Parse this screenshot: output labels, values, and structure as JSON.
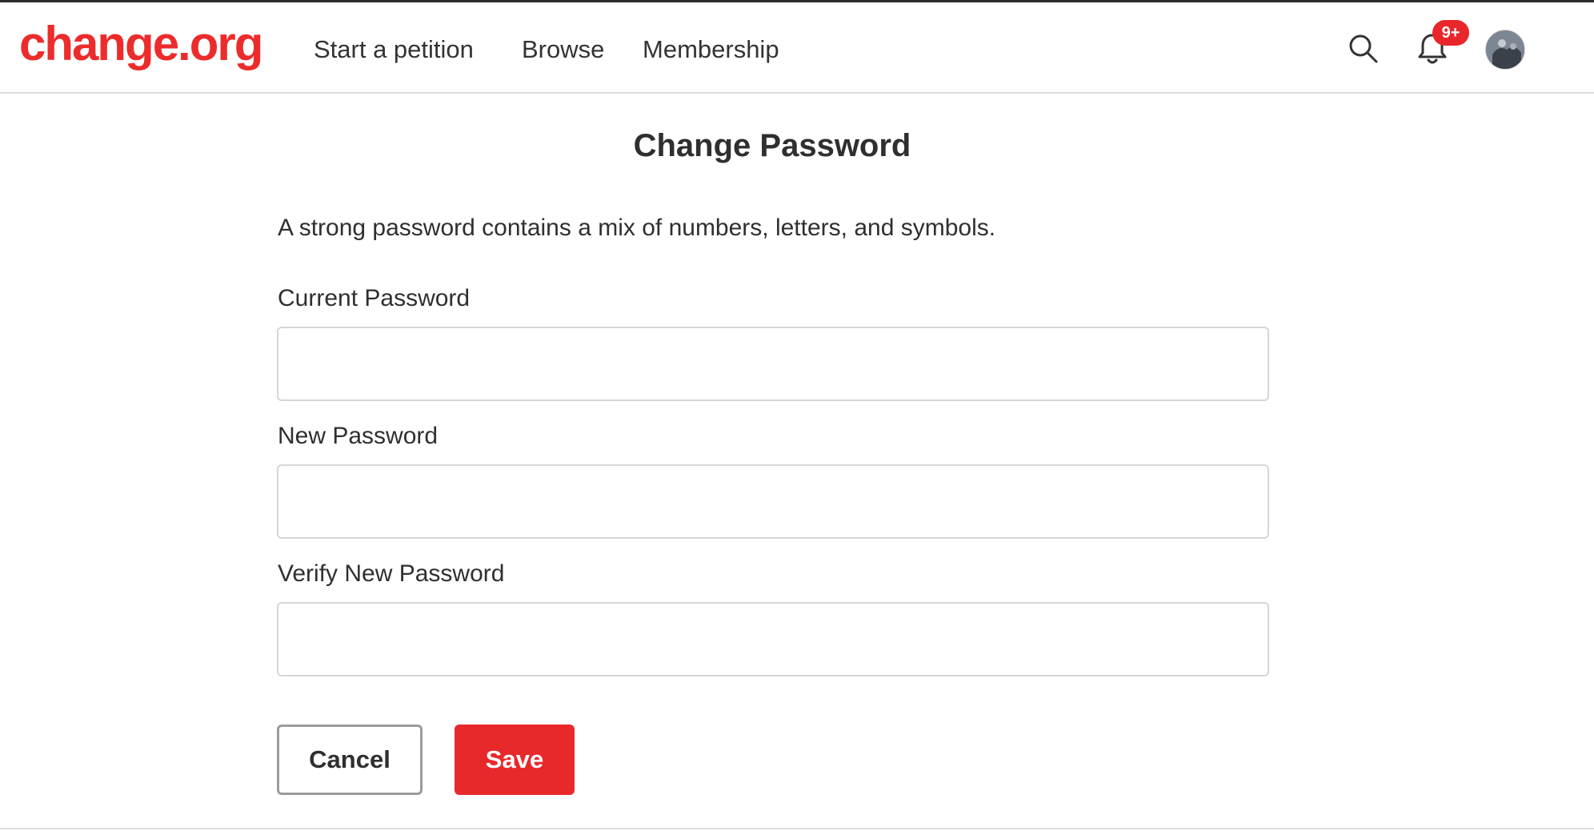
{
  "header": {
    "logo": "change.org",
    "nav": {
      "start_petition": "Start a petition",
      "browse": "Browse",
      "membership": "Membership"
    },
    "notifications_badge": "9+",
    "icons": {
      "search": "search-icon",
      "bell": "bell-icon",
      "avatar": "user-avatar"
    }
  },
  "main": {
    "title": "Change Password",
    "helper_text": "A strong password contains a mix of numbers, letters, and symbols.",
    "fields": {
      "current_label": "Current Password",
      "current_value": "",
      "new_label": "New Password",
      "new_value": "",
      "verify_label": "Verify New Password",
      "verify_value": ""
    },
    "buttons": {
      "cancel": "Cancel",
      "save": "Save"
    }
  },
  "colors": {
    "brand_red": "#ec2c2c",
    "save_button": "#e8292c",
    "badge": "#e8262b"
  }
}
